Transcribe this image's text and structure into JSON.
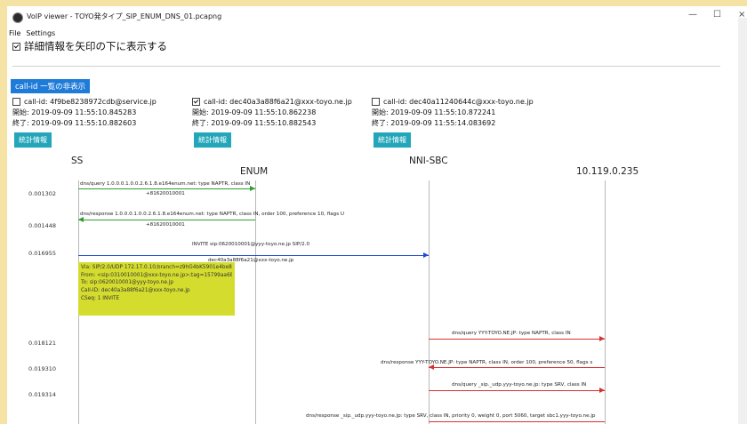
{
  "window": {
    "title": "VoIP viewer - TOYO発タイプ_SIP_ENUM_DNS_01.pcapng",
    "controls": [
      "—",
      "☐",
      "×"
    ]
  },
  "menu": [
    "File",
    "Settings"
  ],
  "detail_toggle": {
    "label": "詳細情報を矢印の下に表示する",
    "checked": true
  },
  "callid_toggle_label": "call-id 一覧の非表示",
  "calls": [
    {
      "label": "call-id: 4f9be8238972cdb@service.jp",
      "checked": false,
      "start": "開始: 2019-09-09 11:55:10.845283",
      "end": "終了: 2019-09-09 11:55:10.882603",
      "stats_label": "統計情報"
    },
    {
      "label": "call-id: dec40a3a88f6a21@xxx-toyo.ne.jp",
      "checked": true,
      "start": "開始: 2019-09-09 11:55:10.862238",
      "end": "終了: 2019-09-09 11:55:10.882543",
      "stats_label": "統計情報"
    },
    {
      "label": "call-id: dec40a11240644c@xxx-toyo.ne.jp",
      "checked": false,
      "start": "開始: 2019-09-09 11:55:10.872241",
      "end": "終了: 2019-09-09 11:55:14.083692",
      "stats_label": "統計情報"
    }
  ],
  "nodes": [
    "SS",
    "ENUM",
    "NNI-SBC",
    "10.119.0.235"
  ],
  "messages": [
    {
      "time": "0.001302",
      "line1": "dns/query 1.0.0.0.1.0.0.2.6.1.8.e164enum.net: type NAPTR, class IN",
      "line2": "+81620010001",
      "color": "#2e9e2e"
    },
    {
      "time": "0.001448",
      "line1": "dns/response 1.0.0.0.1.0.0.2.6.1.8.e164enum.net: type NAPTR, class IN, order 100, preference 10, flags U",
      "line2": "+81620010001",
      "color": "#2e9e2e"
    },
    {
      "time": "0.016955",
      "line1": "INVITE sip:0620010001@yyy-toyo.ne.jp SIP/2.0",
      "line2": "dec40a3a88f6a21@xxx-toyo.ne.jp",
      "color": "#1f4fcf"
    },
    {
      "time": "0.018121",
      "line1": "dns/query YYY-TOYO.NE.JP: type NAPTR, class IN",
      "line2": "",
      "color": "#d83030"
    },
    {
      "time": "0.019310",
      "line1": "dns/response YYY-TOYO.NE.JP: type NAPTR, class IN, order 100, preference 50, flags s",
      "line2": "",
      "color": "#d83030"
    },
    {
      "time": "0.019314",
      "line1": "dns/query _sip._udp.yyy-toyo.ne.jp: type SRV, class IN",
      "line2": "",
      "color": "#d83030"
    },
    {
      "time": "",
      "line1": "dns/response _sip._udp.yyy-toyo.ne.jp: type SRV, class IN, priority 0, weight 0, port 5060, target sbc1.yyy-toyo.ne.jp",
      "line2": "",
      "color": "#d83030"
    }
  ],
  "invite_detail": [
    "Via: SIP/2.0/UDP 172.17.0.10;branch=z9hG4bK5901e4be891e0c2",
    "From: <sip:0310010001@xxx-toyo.ne.jp>;tag=15799aa688d1581",
    "To: sip:0620010001@yyy-toyo.ne.jp",
    "Call-ID: dec40a3a88f6a21@xxx-toyo.ne.jp",
    "CSeq: 1 INVITE"
  ]
}
